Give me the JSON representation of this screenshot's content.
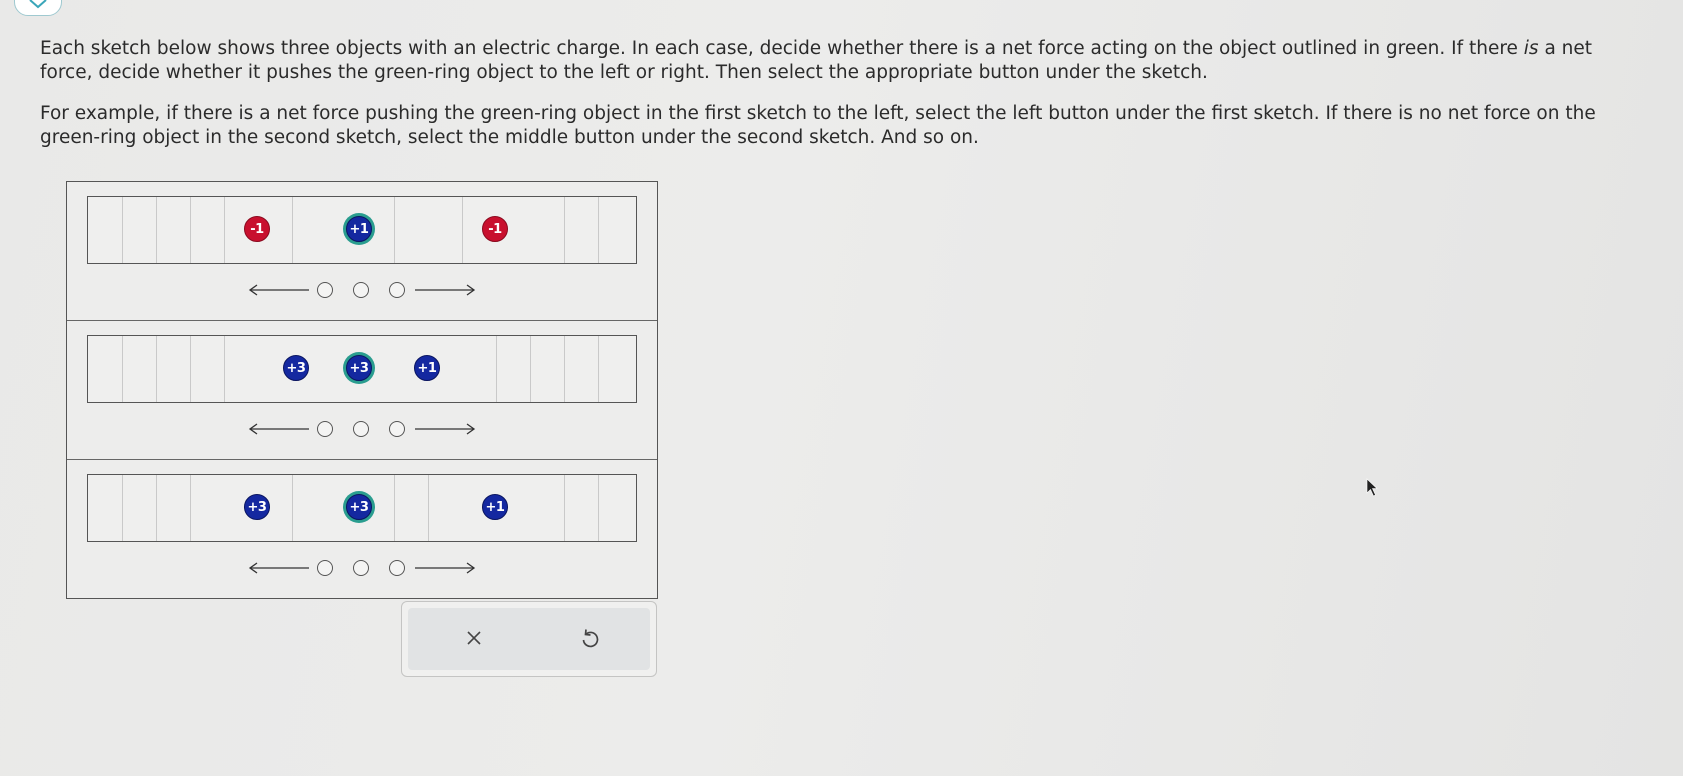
{
  "instructions": {
    "p1_a": "Each sketch below shows three objects with an electric charge. In each case, decide whether there is a net force acting on the object outlined in green. If there ",
    "p1_em": "is",
    "p1_b": " a net force, decide whether it pushes the green-ring object to the left or right. Then select the appropriate button under the sketch.",
    "p2": "For example, if there is a net force pushing the green-ring object in the first sketch to the left, select the left button under the first sketch. If there is no net force on the green-ring object in the second sketch, select the middle button under the second sketch. And so on."
  },
  "sketches": [
    {
      "charges": [
        {
          "label": "-1",
          "sign": "negative",
          "target": false
        },
        {
          "label": "+1",
          "sign": "positive",
          "target": true
        },
        {
          "label": "-1",
          "sign": "negative",
          "target": false
        }
      ]
    },
    {
      "charges": [
        {
          "label": "+3",
          "sign": "positive",
          "target": false
        },
        {
          "label": "+3",
          "sign": "positive",
          "target": true
        },
        {
          "label": "+1",
          "sign": "positive",
          "target": false
        }
      ]
    },
    {
      "charges": [
        {
          "label": "+3",
          "sign": "positive",
          "target": false
        },
        {
          "label": "+3",
          "sign": "positive",
          "target": true
        },
        {
          "label": "+1",
          "sign": "positive",
          "target": false
        }
      ]
    }
  ],
  "answer_options": [
    "left",
    "none",
    "right"
  ],
  "selected_answers": [
    null,
    null,
    null
  ],
  "actions": {
    "clear_icon": "x-icon",
    "undo_icon": "undo-icon",
    "clear_glyph": "×"
  },
  "colors": {
    "negative_charge": "#c8102e",
    "positive_charge": "#1428a0",
    "target_ring": "#2a9d8f"
  }
}
